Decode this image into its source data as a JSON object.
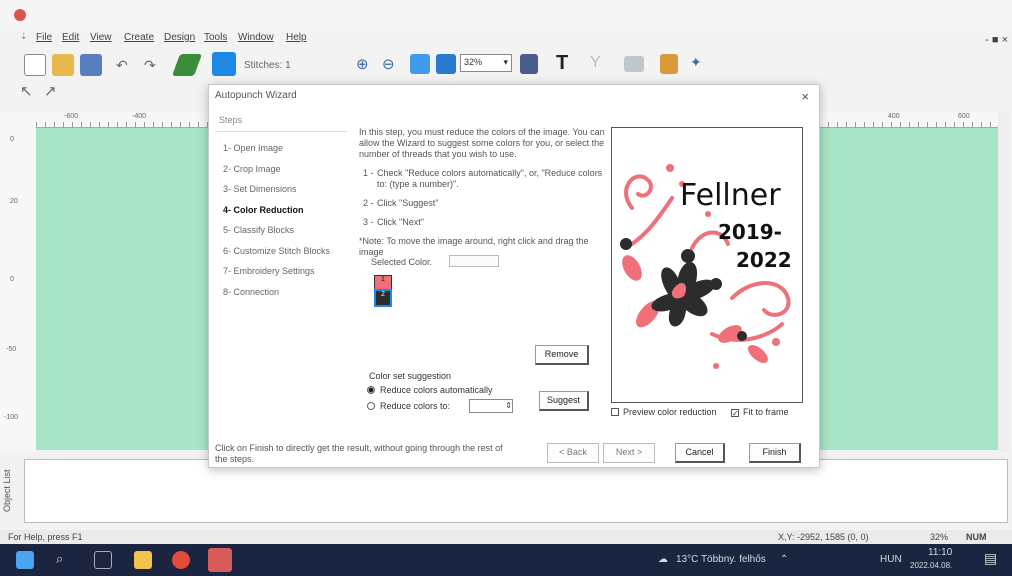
{
  "window": {
    "title": "",
    "controls": "- ■ ×"
  },
  "menu": {
    "quick_access": "⇣",
    "items": [
      "File",
      "Edit",
      "View",
      "Create",
      "Design",
      "Tools",
      "Window",
      "Help"
    ]
  },
  "toolbar": {
    "stitches_label": "Stitches: 1",
    "zoom_value": "32%"
  },
  "ruler": {
    "top_labels": [
      "-600",
      "-400",
      "400",
      "600"
    ],
    "left_labels": [
      "0",
      "20",
      "0",
      "-50",
      "-100"
    ]
  },
  "object_list": {
    "tab_label": "Object List"
  },
  "status": {
    "help": "For Help, press F1",
    "coords": "X,Y: -2952, 1585  (0, 0)",
    "zoom": "32%",
    "num": "NUM"
  },
  "taskbar": {
    "weather": "13°C  Többny. felhős",
    "lang": "HUN",
    "time": "11:10",
    "date": "2022.04.08."
  },
  "dialog": {
    "title": "Autopunch Wizard",
    "close": "×",
    "steps_header": "Steps",
    "steps": [
      "1- Open Image",
      "2- Crop Image",
      "3- Set Dimensions",
      "4- Color Reduction",
      "5- Classify Blocks",
      "6- Customize Stitch Blocks",
      "7- Embroidery Settings",
      "8- Connection"
    ],
    "active_step": 3,
    "intro": "In this step, you must reduce the colors of the image. You can allow the Wizard to suggest some colors for you, or select the number of threads that you wish to use.",
    "instructions": [
      {
        "num": "1 -",
        "text": "Check \"Reduce colors automatically\", or, \"Reduce colors to: (type a number)\"."
      },
      {
        "num": "2 -",
        "text": "Click \"Suggest\""
      },
      {
        "num": "3 -",
        "text": "Click \"Next\""
      }
    ],
    "note": "*Note: To move the image around, right click and drag the image",
    "selected_color_label": "Selected Color.",
    "swatches": [
      {
        "label": "1",
        "color": "#f0707a"
      },
      {
        "label": "2",
        "color": "#2c2c2c"
      }
    ],
    "remove_button": "Remove",
    "color_suggestion_title": "Color set suggestion",
    "radio_auto": "Reduce colors automatically",
    "radio_to": "Reduce colors to:",
    "suggest_button": "Suggest",
    "preview_text": [
      "Fellner",
      "2019-",
      "2022"
    ],
    "preview_checkbox": "Preview color reduction",
    "fit_checkbox": "Fit to frame",
    "footer_note": "Click on Finish to directly get the result, without going through the rest of the steps.",
    "buttons": {
      "back": "< Back",
      "next": "Next >",
      "cancel": "Cancel",
      "finish": "Finish"
    }
  },
  "colors": {
    "canvas": "#a8e4c8",
    "accent": "#1e88e5",
    "motif_pink": "#f0707a",
    "motif_dark": "#2c2c2c"
  }
}
